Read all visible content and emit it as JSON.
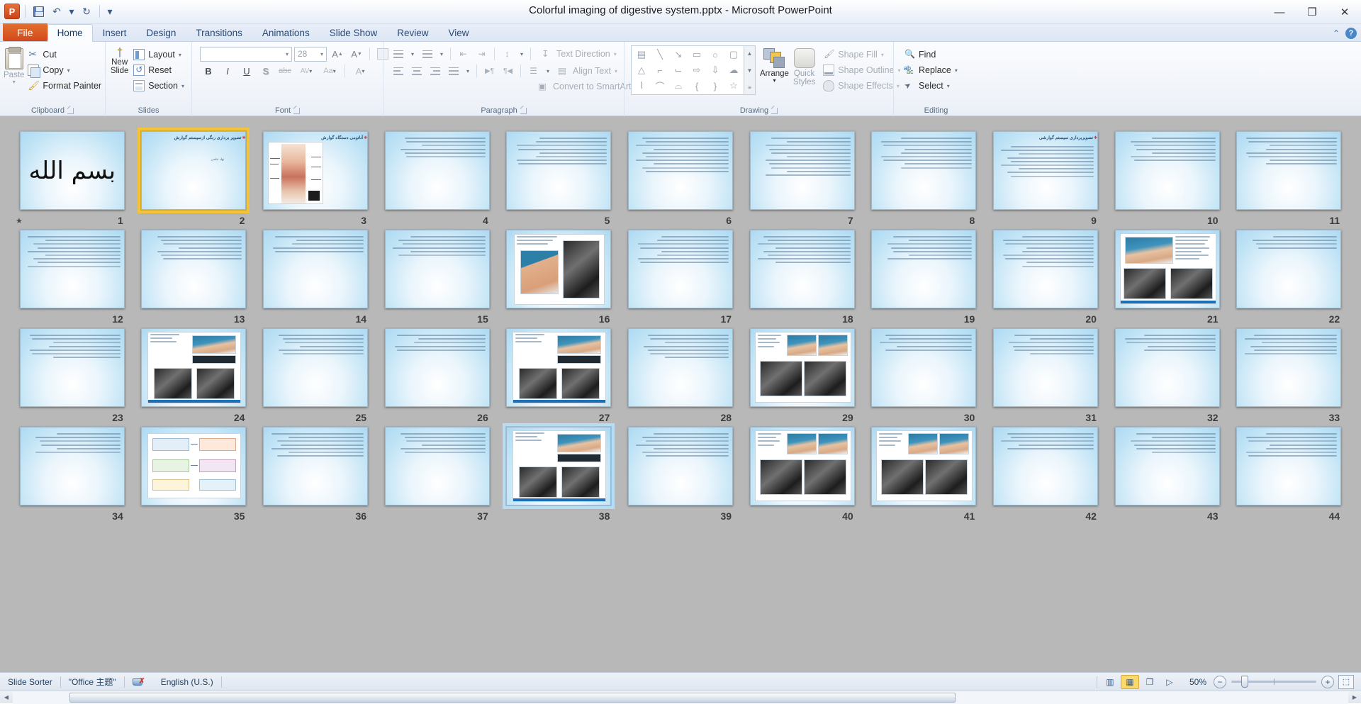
{
  "window": {
    "title": "Colorful imaging of digestive system.pptx  -  Microsoft PowerPoint",
    "app_icon": "P",
    "minimize": "—",
    "restore": "❐",
    "close": "✕"
  },
  "quick_access": [
    {
      "name": "save",
      "label": "▤",
      "tooltip": "Save"
    },
    {
      "name": "undo",
      "label": "↶",
      "tooltip": "Undo"
    },
    {
      "name": "undo-dropdown",
      "label": "▾"
    },
    {
      "name": "redo",
      "label": "↻",
      "tooltip": "Redo"
    },
    {
      "name": "customize-qat",
      "label": "▾"
    }
  ],
  "tabs": [
    {
      "label": "File",
      "kind": "file"
    },
    {
      "label": "Home",
      "kind": "active"
    },
    {
      "label": "Insert",
      "kind": "normal"
    },
    {
      "label": "Design",
      "kind": "normal"
    },
    {
      "label": "Transitions",
      "kind": "normal"
    },
    {
      "label": "Animations",
      "kind": "normal"
    },
    {
      "label": "Slide Show",
      "kind": "normal"
    },
    {
      "label": "Review",
      "kind": "normal"
    },
    {
      "label": "View",
      "kind": "normal"
    }
  ],
  "tab_right": {
    "minimize_ribbon": "⌃",
    "help": "?"
  },
  "ribbon": {
    "groups": [
      {
        "label": "Clipboard",
        "launcher": true
      },
      {
        "label": "Slides",
        "launcher": false
      },
      {
        "label": "Font",
        "launcher": true
      },
      {
        "label": "Paragraph",
        "launcher": true
      },
      {
        "label": "Drawing",
        "launcher": true
      },
      {
        "label": "Editing",
        "launcher": false
      }
    ],
    "clipboard": {
      "paste": "Paste",
      "paste_caret": "▾",
      "cut": "Cut",
      "copy": "Copy",
      "format_painter": "Format Painter"
    },
    "slides": {
      "new_slide_line1": "New",
      "new_slide_line2": "Slide",
      "new_slide_caret": "▾",
      "layout": "Layout",
      "reset": "Reset",
      "section": "Section"
    },
    "font": {
      "font_name_value": "",
      "font_name_placeholder": "",
      "font_size_value": "28",
      "grow_font": "A",
      "shrink_font": "A",
      "clear_formatting": "A",
      "bold": "B",
      "italic": "I",
      "underline": "U",
      "shadow": "S",
      "strikethrough": "abc",
      "character_spacing": "AV",
      "change_case": "Aa",
      "font_color": "A"
    },
    "paragraph": {
      "bullets": "≡",
      "numbering": "≡",
      "decrease_indent": "⇤",
      "increase_indent": "⇥",
      "line_spacing": "↕",
      "align_left": "≡",
      "align_center": "≡",
      "align_right": "≡",
      "justify": "≡",
      "ltr": "▶¶",
      "rtl": "¶◀",
      "columns": "☰",
      "text_direction": "Text Direction",
      "align_text": "Align Text",
      "convert_smartart": "Convert to SmartArt"
    },
    "drawing": {
      "shapes": [
        "▤",
        "╲",
        "↘",
        "▭",
        "○",
        "▢",
        "△",
        "⌐",
        "⌙",
        "⇨",
        "⇩",
        "☁",
        "⌇",
        "⌒",
        "⌓",
        "{",
        "}",
        "☆"
      ],
      "scroll_up": "▲",
      "scroll_down": "▼",
      "scroll_more": "≡",
      "arrange": "Arrange",
      "arrange_caret": "▾",
      "quick_styles_line1": "Quick",
      "quick_styles_line2": "Styles",
      "shape_fill": "Shape Fill",
      "shape_outline": "Shape Outline",
      "shape_effects": "Shape Effects"
    },
    "editing": {
      "find": "Find",
      "replace": "Replace",
      "select": "Select"
    }
  },
  "status_bar": {
    "view_name": "Slide Sorter",
    "theme": "\"Office 主题\"",
    "spellcheck_icon": "spell-check-icon",
    "language": "English (U.S.)",
    "view_buttons": [
      {
        "name": "normal-view",
        "glyph": "▥",
        "active": false
      },
      {
        "name": "slide-sorter-view",
        "glyph": "▦",
        "active": true
      },
      {
        "name": "reading-view",
        "glyph": "❐",
        "active": false
      },
      {
        "name": "slide-show-view",
        "glyph": "▷",
        "active": false
      }
    ],
    "zoom_level": "50%",
    "zoom_out": "−",
    "zoom_in": "+",
    "fit_to_window": "⬚"
  },
  "scrollbar": {
    "left_arrow": "◀",
    "right_arrow": "▶"
  },
  "sorter": {
    "selected_slide": 2,
    "hovered_slide": 38,
    "rows": [
      [
        {
          "n": 1,
          "kind": "calligraphy",
          "title": "",
          "anim": true
        },
        {
          "n": 2,
          "kind": "title-slide",
          "title": "تصویر برداری رنگی ازسیستم گوارش",
          "subtitle": "نهاد علمی"
        },
        {
          "n": 3,
          "kind": "anatomy",
          "title": "آناتومی دستگاه گوارش"
        },
        {
          "n": 4,
          "kind": "text",
          "lines": 6
        },
        {
          "n": 5,
          "kind": "text",
          "lines": 8
        },
        {
          "n": 6,
          "kind": "text",
          "lines": 10
        },
        {
          "n": 7,
          "kind": "text",
          "lines": 11
        },
        {
          "n": 8,
          "kind": "text",
          "lines": 9
        },
        {
          "n": 9,
          "kind": "titled-text",
          "title": "تصویربرداری سیستم گوارشی",
          "lines": 9
        },
        {
          "n": 10,
          "kind": "text",
          "lines": 7
        },
        {
          "n": 11,
          "kind": "text",
          "lines": 8
        }
      ],
      [
        {
          "n": 12,
          "kind": "text",
          "lines": 9
        },
        {
          "n": 13,
          "kind": "text",
          "lines": 7
        },
        {
          "n": 14,
          "kind": "text",
          "lines": 5
        },
        {
          "n": 15,
          "kind": "text",
          "lines": 6
        },
        {
          "n": 16,
          "kind": "photo-xray"
        },
        {
          "n": 17,
          "kind": "text",
          "lines": 8
        },
        {
          "n": 18,
          "kind": "text",
          "lines": 8
        },
        {
          "n": 19,
          "kind": "text",
          "lines": 7
        },
        {
          "n": 20,
          "kind": "text",
          "lines": 9
        },
        {
          "n": 21,
          "kind": "photo-grid"
        },
        {
          "n": 22,
          "kind": "text",
          "lines": 4
        }
      ],
      [
        {
          "n": 23,
          "kind": "text",
          "lines": 7
        },
        {
          "n": 24,
          "kind": "photo-two-xray"
        },
        {
          "n": 25,
          "kind": "text",
          "lines": 6
        },
        {
          "n": 26,
          "kind": "text",
          "lines": 5
        },
        {
          "n": 27,
          "kind": "photo-two-xray"
        },
        {
          "n": 28,
          "kind": "text",
          "lines": 7
        },
        {
          "n": 29,
          "kind": "photo-quad"
        },
        {
          "n": 30,
          "kind": "text",
          "lines": 5
        },
        {
          "n": 31,
          "kind": "text",
          "lines": 6
        },
        {
          "n": 32,
          "kind": "text",
          "lines": 5
        },
        {
          "n": 33,
          "kind": "text",
          "lines": 6
        }
      ],
      [
        {
          "n": 34,
          "kind": "text",
          "lines": 6
        },
        {
          "n": 35,
          "kind": "diagram"
        },
        {
          "n": 36,
          "kind": "text",
          "lines": 7
        },
        {
          "n": 37,
          "kind": "text",
          "lines": 6
        },
        {
          "n": 38,
          "kind": "photo-two-xray"
        },
        {
          "n": 39,
          "kind": "text",
          "lines": 7
        },
        {
          "n": 40,
          "kind": "photo-quad"
        },
        {
          "n": 41,
          "kind": "photo-quad"
        },
        {
          "n": 42,
          "kind": "text",
          "lines": 5
        },
        {
          "n": 43,
          "kind": "text",
          "lines": 6
        },
        {
          "n": 44,
          "kind": "text",
          "lines": 7
        }
      ]
    ]
  },
  "colors": {
    "file_tab": "#d2491c",
    "selection": "#f2c43d",
    "hover": "#b8dcf2",
    "sorter_bg": "#b8b8b8",
    "slide_bg": "#bfe3f5",
    "title_text": "#1f4e79"
  }
}
